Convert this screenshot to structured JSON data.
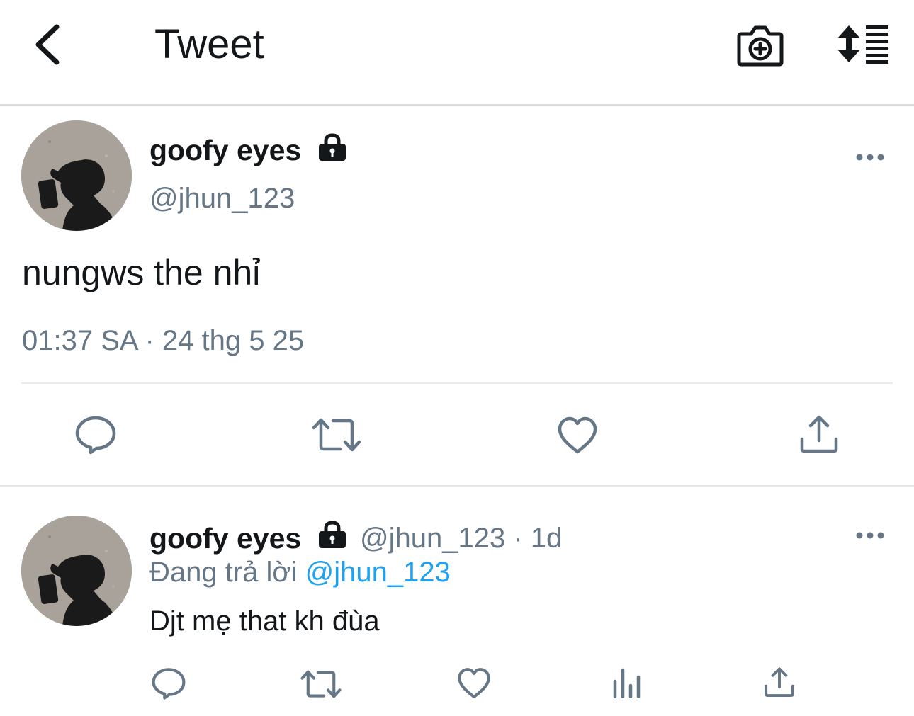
{
  "header": {
    "title": "Tweet",
    "icons": [
      "back-icon",
      "camera-plus-icon",
      "sort-lines-icon"
    ]
  },
  "main_tweet": {
    "author_name": "goofy eyes",
    "handle": "@jhun_123",
    "text": "nungws the nhỉ",
    "timestamp": "01:37 SA · 24 thg 5 25",
    "actions": [
      "reply-icon",
      "retweet-icon",
      "like-icon",
      "share-icon"
    ]
  },
  "reply": {
    "author_name": "goofy eyes",
    "handle": "@jhun_123",
    "time_sep": "·",
    "time": "1d",
    "replying_label": "Đang trả lời",
    "replying_to": "@jhun_123",
    "text": "Djt mẹ that kh đùa",
    "actions": [
      "reply-icon",
      "retweet-icon",
      "like-icon",
      "analytics-icon",
      "share-icon"
    ]
  },
  "colors": {
    "primary_text": "#14171a",
    "secondary_text": "#657786",
    "link": "#1da1f2",
    "icon": "#657786"
  }
}
